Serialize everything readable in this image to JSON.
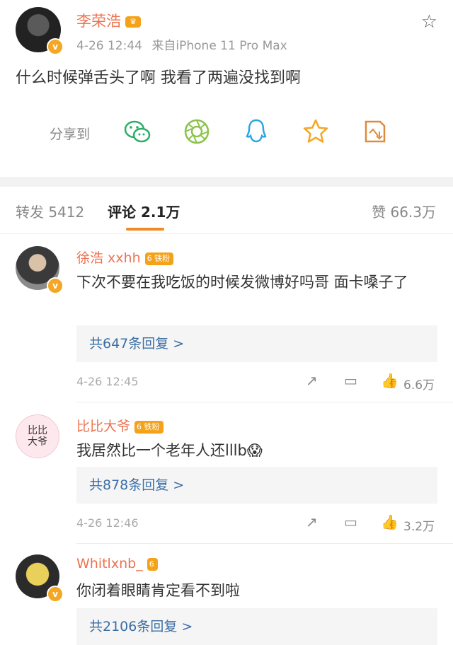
{
  "post": {
    "author": "李荣浩",
    "crown": "♛",
    "time": "4-26 12:44",
    "source": "来自iPhone 11 Pro Max",
    "text": "什么时候弹舌头了啊 我看了两遍没找到啊",
    "share_label": "分享到"
  },
  "tabs": {
    "repost": "转发 5412",
    "comments": "评论 2.1万",
    "likes": "赞 66.3万"
  },
  "comments": [
    {
      "name": "徐浩 xxhh",
      "fan": "6 铁粉",
      "text": "下次不要在我吃饭的时候发微博好吗哥 面卡嗓子了",
      "replies": "共647条回复 >",
      "time": "4-26 12:45",
      "likes": "6.6万"
    },
    {
      "name": "比比大爷",
      "fan": "6 铁粉",
      "text": "我居然比一个老年人还lllb😱",
      "replies": "共878条回复 >",
      "time": "4-26 12:46",
      "likes": "3.2万"
    },
    {
      "name": "Whitlxnb_",
      "fan": "6",
      "text": "你闭着眼睛肯定看不到啦",
      "replies": "共2106条回复 >"
    }
  ],
  "avatar2_text": "比比大爷"
}
